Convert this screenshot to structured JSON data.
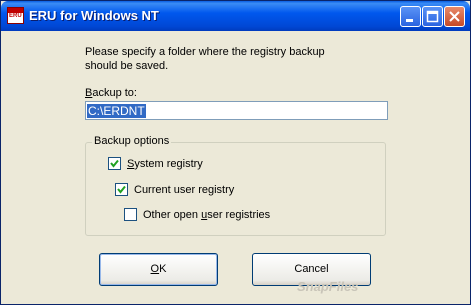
{
  "window": {
    "title": "ERU for Windows NT",
    "icon_text": "ERU"
  },
  "dialog": {
    "prompt": "Please specify a folder where the registry backup should be saved.",
    "backup_to_label_underlined": "B",
    "backup_to_label_rest": "ackup to:",
    "backup_path": "C:\\ERDNT"
  },
  "options": {
    "group_title": "Backup options",
    "system_registry": {
      "underlined": "S",
      "rest": "ystem registry",
      "checked": true
    },
    "current_user_registry": {
      "underlined": "",
      "rest": "Current user registry",
      "checked": true
    },
    "other_user_registries": {
      "before": "Other open ",
      "underlined": "u",
      "rest": "ser registries",
      "checked": false
    }
  },
  "buttons": {
    "ok_underlined": "O",
    "ok_rest": "K",
    "cancel_label": "Cancel"
  },
  "watermark": "SnapFiles"
}
